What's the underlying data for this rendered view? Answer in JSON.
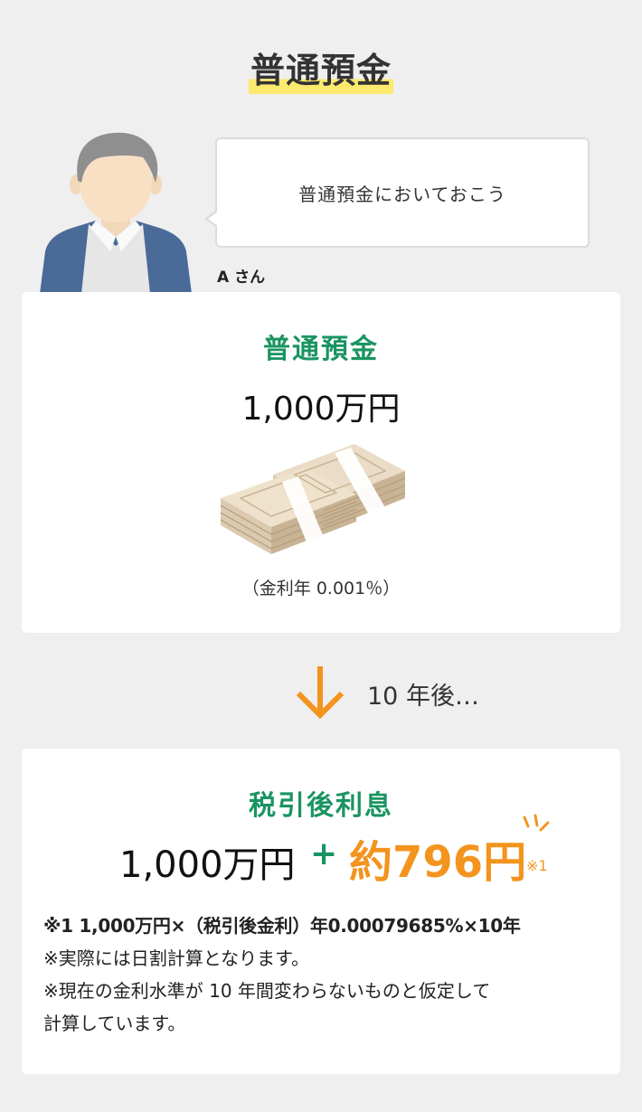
{
  "title": "普通預金",
  "bubble": {
    "text": "普通預金においておこう",
    "speaker": "A さん"
  },
  "card1": {
    "heading": "普通預金",
    "amount": "1,000万円",
    "rate_note": "（金利年 0.001％）"
  },
  "arrow": {
    "text": "10 年後…"
  },
  "card2": {
    "heading": "税引後利息",
    "base_amount": "1,000万円",
    "plus": "+",
    "interest": "約796円",
    "footnote_mark": "※1",
    "notes": [
      "※1 1,000万円×（税引後金利）年0.00079685%×10年",
      "※実際には日割計算となります。",
      "※現在の金利水準が 10 年間変わらないものと仮定して",
      "計算しています。"
    ]
  },
  "colors": {
    "accent_green": "#1a9462",
    "accent_orange": "#f3941e",
    "title_highlight": "#fbea6d"
  },
  "icons": [
    "person-avatar",
    "money-stack-icon",
    "arrow-down-icon",
    "sparkle-icon"
  ]
}
